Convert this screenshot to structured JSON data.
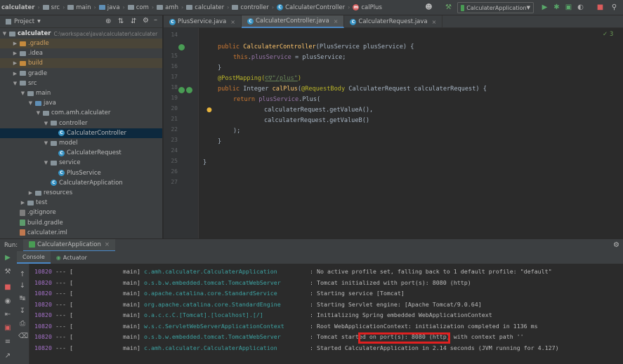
{
  "breadcrumb": [
    "calculater",
    "src",
    "main",
    "java",
    "com",
    "amh",
    "calculater",
    "controller",
    "CalculaterController",
    "calPlus"
  ],
  "run_config": "CalculaterApplication",
  "project": {
    "header": "Project",
    "root_name": "calculater",
    "root_path": "C:\\workspace\\java\\calculater\\calculater",
    "tree": [
      {
        "label": ".gradle",
        "depth": 1,
        "arrow": "right",
        "icon": "folder-orange",
        "hl": true
      },
      {
        "label": ".idea",
        "depth": 1,
        "arrow": "right",
        "icon": "folder",
        "hl": false
      },
      {
        "label": "build",
        "depth": 1,
        "arrow": "right",
        "icon": "folder-orange",
        "hl": true
      },
      {
        "label": "gradle",
        "depth": 1,
        "arrow": "right",
        "icon": "folder",
        "hl": false
      },
      {
        "label": "src",
        "depth": 1,
        "arrow": "down",
        "icon": "folder",
        "hl": false
      },
      {
        "label": "main",
        "depth": 2,
        "arrow": "down",
        "icon": "folder",
        "hl": false
      },
      {
        "label": "java",
        "depth": 3,
        "arrow": "down",
        "icon": "folder-blue",
        "hl": false
      },
      {
        "label": "com.amh.calculater",
        "depth": 4,
        "arrow": "down",
        "icon": "folder",
        "hl": false
      },
      {
        "label": "controller",
        "depth": 5,
        "arrow": "down",
        "icon": "folder",
        "hl": false
      },
      {
        "label": "CalculaterController",
        "depth": 6,
        "arrow": "",
        "icon": "class",
        "sel": true
      },
      {
        "label": "model",
        "depth": 5,
        "arrow": "down",
        "icon": "folder",
        "hl": false
      },
      {
        "label": "CalculaterRequest",
        "depth": 6,
        "arrow": "",
        "icon": "class",
        "hl": false
      },
      {
        "label": "service",
        "depth": 5,
        "arrow": "down",
        "icon": "folder",
        "hl": false
      },
      {
        "label": "PlusService",
        "depth": 6,
        "arrow": "",
        "icon": "class",
        "hl": false
      },
      {
        "label": "CalculaterApplication",
        "depth": 5,
        "arrow": "",
        "icon": "app",
        "hl": false
      },
      {
        "label": "resources",
        "depth": 3,
        "arrow": "right",
        "icon": "folder",
        "hl": false
      },
      {
        "label": "test",
        "depth": 2,
        "arrow": "right",
        "icon": "folder",
        "hl": false
      },
      {
        "label": ".gitignore",
        "depth": 1,
        "arrow": "",
        "icon": "file-git",
        "hl": false
      },
      {
        "label": "build.gradle",
        "depth": 1,
        "arrow": "",
        "icon": "file-gradle",
        "hl": false
      },
      {
        "label": "calculater.iml",
        "depth": 1,
        "arrow": "",
        "icon": "file-xml",
        "hl": false
      }
    ]
  },
  "editor": {
    "tabs": [
      {
        "label": "PlusService.java",
        "active": false
      },
      {
        "label": "CalculaterController.java",
        "active": true
      },
      {
        "label": "CalculaterRequest.java",
        "active": false
      }
    ],
    "warnings": "3",
    "line_numbers": [
      "14",
      "15",
      "16",
      "17",
      "18",
      "19",
      "20",
      "21",
      "22",
      "23",
      "24",
      "25",
      "26",
      "27"
    ]
  },
  "run": {
    "label": "Run:",
    "config": "CalculaterApplication",
    "tabs": [
      "Console",
      "Actuator"
    ],
    "logs": [
      {
        "pid": "10820",
        "sep": "--- [",
        "thread": "main]",
        "logger": "c.amh.calculater.CalculaterApplication",
        "msg": ": No active profile set, falling back to 1 default profile: \"default\""
      },
      {
        "pid": "10820",
        "sep": "--- [",
        "thread": "main]",
        "logger": "o.s.b.w.embedded.tomcat.TomcatWebServer",
        "msg": ": Tomcat initialized with port(s): 8080 (http)"
      },
      {
        "pid": "10820",
        "sep": "--- [",
        "thread": "main]",
        "logger": "o.apache.catalina.core.StandardService",
        "msg": ": Starting service [Tomcat]"
      },
      {
        "pid": "10820",
        "sep": "--- [",
        "thread": "main]",
        "logger": "org.apache.catalina.core.StandardEngine",
        "msg": ": Starting Servlet engine: [Apache Tomcat/9.0.64]"
      },
      {
        "pid": "10820",
        "sep": "--- [",
        "thread": "main]",
        "logger": "o.a.c.c.C.[Tomcat].[localhost].[/]",
        "msg": ": Initializing Spring embedded WebApplicationContext"
      },
      {
        "pid": "10820",
        "sep": "--- [",
        "thread": "main]",
        "logger": "w.s.c.ServletWebServerApplicationContext",
        "msg": ": Root WebApplicationContext: initialization completed in 1136 ms"
      },
      {
        "pid": "10820",
        "sep": "--- [",
        "thread": "main]",
        "logger": "o.s.b.w.embedded.tomcat.TomcatWebServer",
        "msg": ": Tomcat started on port(s): 8080 (http) with context path ''"
      },
      {
        "pid": "10820",
        "sep": "--- [",
        "thread": "main]",
        "logger": "c.amh.calculater.CalculaterApplication",
        "msg": ": Started CalculaterApplication in 2.14 seconds (JVM running for 4.127)"
      }
    ]
  },
  "code": {
    "l15_a": "public ",
    "l15_b": "CalculaterController",
    "l15_c": "(PlusService plusService) {",
    "l16_a": "this",
    "l16_b": ".",
    "l16_c": "plusService",
    "l16_d": " = plusService;",
    "l17": "}",
    "l18_a": "@PostMapping(",
    "l18_b": "©∇\"/plus\"",
    "l18_c": ")",
    "l19_a": "public ",
    "l19_b": "Integer ",
    "l19_c": "calPlus",
    "l19_d": "(",
    "l19_e": "@RequestBody ",
    "l19_f": "CalculaterRequest calculaterRequest) {",
    "l20_a": "return ",
    "l20_b": "plusService",
    "l20_c": ".Plus(",
    "l21": "calculaterRequest.getValueA(),",
    "l22": "calculaterRequest.getValueB()",
    "l23": ");",
    "l24": "}",
    "l26": "}"
  },
  "colors": {
    "accent": "#4a88c7",
    "highlight_box": "#e02020",
    "background": "#2b2b2b"
  }
}
